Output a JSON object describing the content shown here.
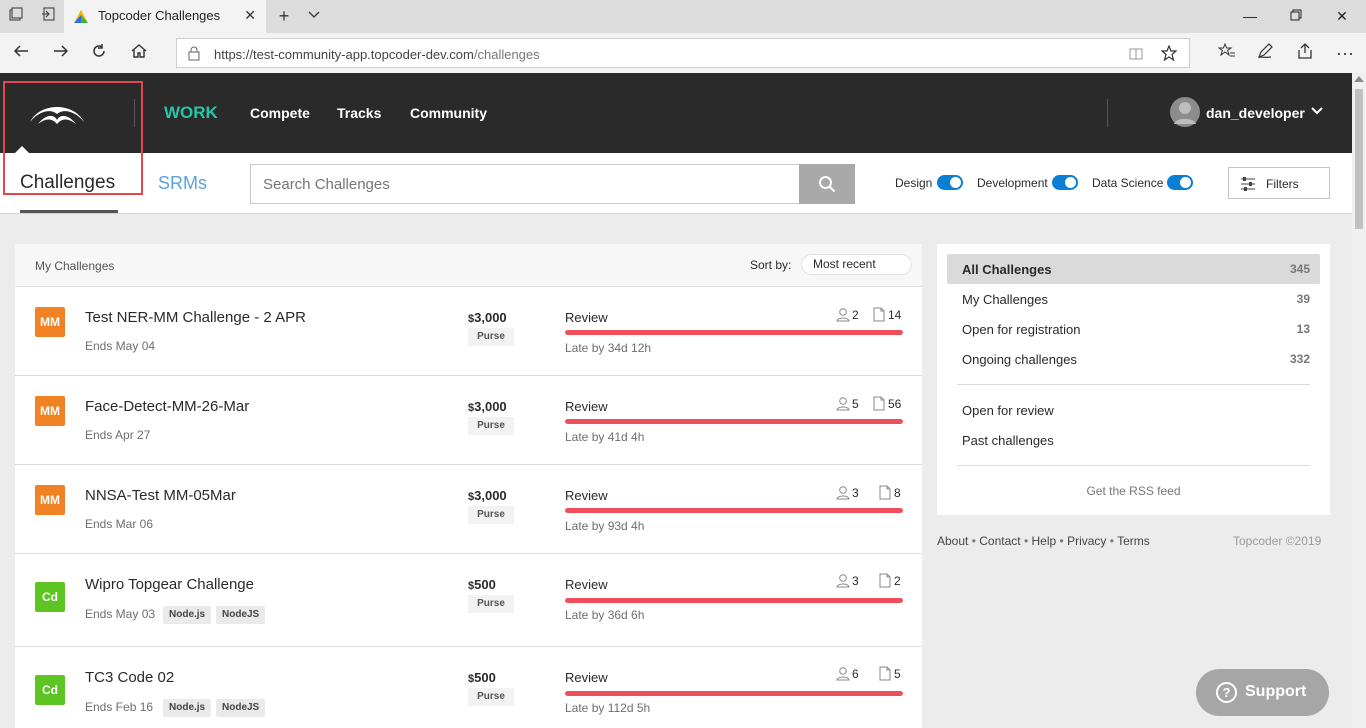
{
  "browser": {
    "tab_title": "Topcoder Challenges",
    "url_host": "https://test-community-app.topcoder-dev.com",
    "url_path": "/challenges"
  },
  "header": {
    "work_label": "WORK",
    "nav": [
      "Compete",
      "Tracks",
      "Community"
    ],
    "username": "dan_developer"
  },
  "subnav": {
    "challenges_tab": "Challenges",
    "srms_tab": "SRMs",
    "search_placeholder": "Search Challenges",
    "toggles": [
      "Design",
      "Development",
      "Data Science"
    ],
    "filters_label": "Filters"
  },
  "list": {
    "title": "My Challenges",
    "sort_label": "Sort by:",
    "sort_value": "Most recent",
    "rows": [
      {
        "track": "MM",
        "name": "Test NER-MM Challenge - 2 APR",
        "ends": "Ends May 04",
        "tags": [],
        "prize": "3,000",
        "purse": "Purse",
        "phase": "Review",
        "late": "Late by 34d 12h",
        "registrants": "2",
        "submissions": "14",
        "progress": 1
      },
      {
        "track": "MM",
        "name": "Face-Detect-MM-26-Mar",
        "ends": "Ends Apr 27",
        "tags": [],
        "prize": "3,000",
        "purse": "Purse",
        "phase": "Review",
        "late": "Late by 41d 4h",
        "registrants": "5",
        "submissions": "56",
        "progress": 1
      },
      {
        "track": "MM",
        "name": "NNSA-Test MM-05Mar",
        "ends": "Ends Mar 06",
        "tags": [],
        "prize": "3,000",
        "purse": "Purse",
        "phase": "Review",
        "late": "Late by 93d 4h",
        "registrants": "3",
        "submissions": "8",
        "progress": 1
      },
      {
        "track": "Cd",
        "name": "Wipro Topgear Challenge",
        "ends": "Ends May 03",
        "tags": [
          "Node.js",
          "NodeJS"
        ],
        "prize": "500",
        "purse": "Purse",
        "phase": "Review",
        "late": "Late by 36d 6h",
        "registrants": "3",
        "submissions": "2",
        "progress": 1
      },
      {
        "track": "Cd",
        "name": "TC3 Code 02",
        "ends": "Ends Feb 16",
        "tags": [
          "Node.js",
          "NodeJS"
        ],
        "prize": "500",
        "purse": "Purse",
        "phase": "Review",
        "late": "Late by 112d 5h",
        "registrants": "6",
        "submissions": "5",
        "progress": 1
      }
    ]
  },
  "sidebar": {
    "buckets": [
      {
        "label": "All Challenges",
        "count": "345"
      },
      {
        "label": "My Challenges",
        "count": "39"
      },
      {
        "label": "Open for registration",
        "count": "13"
      },
      {
        "label": "Ongoing challenges",
        "count": "332"
      }
    ],
    "past_buckets": [
      "Open for review",
      "Past challenges"
    ],
    "rss": "Get the RSS feed"
  },
  "footer": {
    "links": [
      "About",
      "Contact",
      "Help",
      "Privacy",
      "Terms"
    ],
    "separator": "•",
    "copyright": "Topcoder ©2019"
  },
  "support_label": "Support",
  "colors": {
    "header_bg": "#2a2a2a",
    "work_accent": "#29c4a8",
    "srm_link": "#5aa2e0",
    "toggle_on": "#0b7fd6",
    "mm_track": "#f08224",
    "code_track": "#5cc521",
    "late_bar": "#ef4f5a",
    "highlight": "#e2474d"
  }
}
